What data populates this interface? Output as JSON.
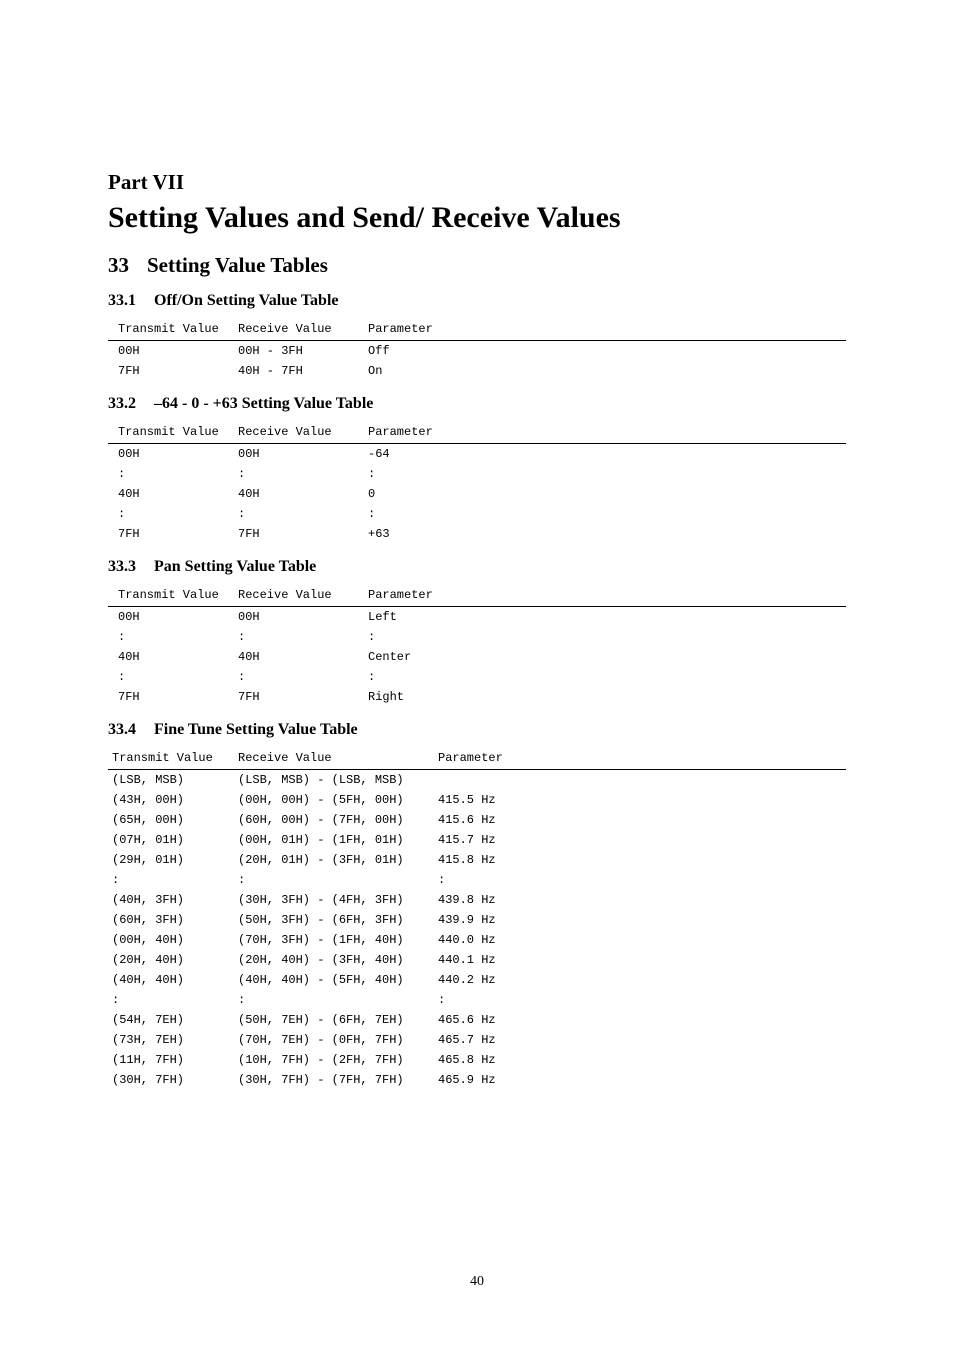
{
  "part": {
    "label": "Part VII",
    "title": "Setting Values and Send/ Receive Values"
  },
  "section": {
    "num": "33",
    "title": "Setting Value Tables"
  },
  "subsections": {
    "s1": {
      "num": "33.1",
      "title": "Off/On Setting Value Table"
    },
    "s2": {
      "num": "33.2",
      "title": "–64 - 0 - +63 Setting Value Table"
    },
    "s3": {
      "num": "33.3",
      "title": "Pan Setting Value Table"
    },
    "s4": {
      "num": "33.4",
      "title": "Fine Tune Setting Value Table"
    }
  },
  "headers3": {
    "transmit": "Transmit Value",
    "receive": "Receive Value",
    "param": "Parameter"
  },
  "tables": {
    "t1": [
      {
        "tx": "00H",
        "rx": "00H - 3FH",
        "p": "Off"
      },
      {
        "tx": "7FH",
        "rx": "40H - 7FH",
        "p": "On"
      }
    ],
    "t2": [
      {
        "tx": "00H",
        "rx": "00H",
        "p": "-64"
      },
      {
        "tx": ":",
        "rx": ":",
        "p": ":"
      },
      {
        "tx": "40H",
        "rx": "40H",
        "p": "0"
      },
      {
        "tx": ":",
        "rx": ":",
        "p": ":"
      },
      {
        "tx": "7FH",
        "rx": "7FH",
        "p": "+63"
      }
    ],
    "t3": [
      {
        "tx": "00H",
        "rx": "00H",
        "p": "Left"
      },
      {
        "tx": ":",
        "rx": ":",
        "p": ":"
      },
      {
        "tx": "40H",
        "rx": "40H",
        "p": "Center"
      },
      {
        "tx": ":",
        "rx": ":",
        "p": ":"
      },
      {
        "tx": "7FH",
        "rx": "7FH",
        "p": "Right"
      }
    ],
    "t4": [
      {
        "tx": "(LSB, MSB)",
        "rx": "(LSB, MSB) - (LSB, MSB)",
        "p": ""
      },
      {
        "tx": "(43H, 00H)",
        "rx": "(00H, 00H) - (5FH, 00H)",
        "p": "415.5 Hz"
      },
      {
        "tx": "(65H, 00H)",
        "rx": "(60H, 00H) - (7FH, 00H)",
        "p": "415.6 Hz"
      },
      {
        "tx": "(07H, 01H)",
        "rx": "(00H, 01H) - (1FH, 01H)",
        "p": "415.7 Hz"
      },
      {
        "tx": "(29H, 01H)",
        "rx": "(20H, 01H) - (3FH, 01H)",
        "p": "415.8 Hz"
      },
      {
        "tx": ":",
        "rx": ":",
        "p": ":"
      },
      {
        "tx": "(40H, 3FH)",
        "rx": "(30H, 3FH) - (4FH, 3FH)",
        "p": "439.8 Hz"
      },
      {
        "tx": "(60H, 3FH)",
        "rx": "(50H, 3FH) - (6FH, 3FH)",
        "p": "439.9 Hz"
      },
      {
        "tx": "(00H, 40H)",
        "rx": "(70H, 3FH) - (1FH, 40H)",
        "p": "440.0 Hz"
      },
      {
        "tx": "(20H, 40H)",
        "rx": "(20H, 40H) - (3FH, 40H)",
        "p": "440.1 Hz"
      },
      {
        "tx": "(40H, 40H)",
        "rx": "(40H, 40H) - (5FH, 40H)",
        "p": "440.2 Hz"
      },
      {
        "tx": ":",
        "rx": ":",
        "p": ":"
      },
      {
        "tx": "(54H, 7EH)",
        "rx": "(50H, 7EH) - (6FH, 7EH)",
        "p": "465.6 Hz"
      },
      {
        "tx": "(73H, 7EH)",
        "rx": "(70H, 7EH) - (0FH, 7FH)",
        "p": "465.7 Hz"
      },
      {
        "tx": "(11H, 7FH)",
        "rx": "(10H, 7FH) - (2FH, 7FH)",
        "p": "465.8 Hz"
      },
      {
        "tx": "(30H, 7FH)",
        "rx": "(30H, 7FH) - (7FH, 7FH)",
        "p": "465.9 Hz"
      }
    ]
  },
  "page_number": "40"
}
